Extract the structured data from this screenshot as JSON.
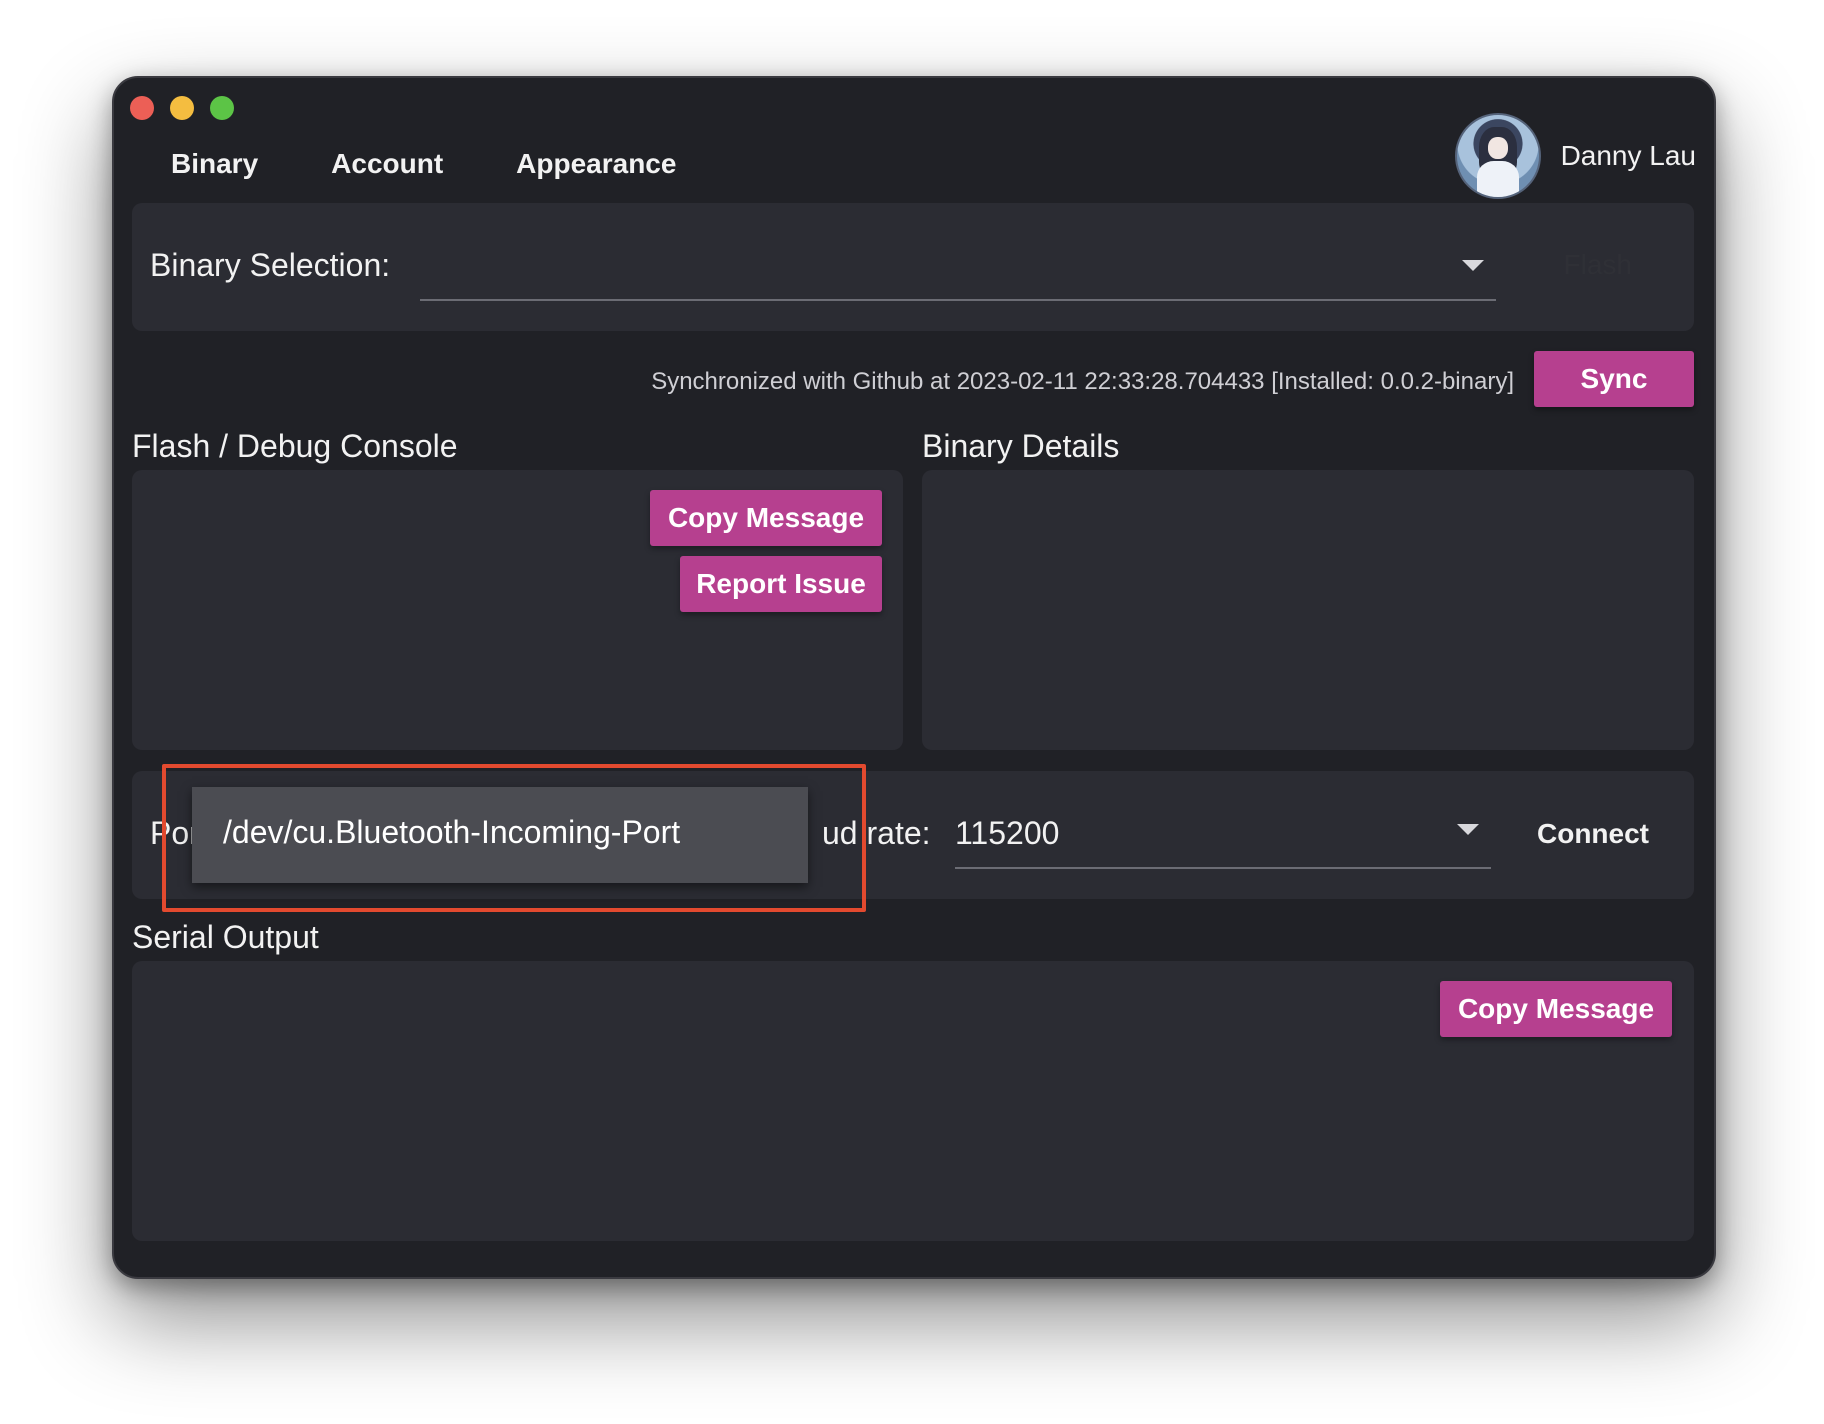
{
  "window": {
    "controls": [
      "close",
      "minimize",
      "maximize"
    ]
  },
  "nav": {
    "tabs": [
      {
        "label": "Binary"
      },
      {
        "label": "Account"
      },
      {
        "label": "Appearance"
      }
    ]
  },
  "user": {
    "name": "Danny Lau",
    "avatar_icon": "user-avatar"
  },
  "binary_selection": {
    "label": "Binary Selection:",
    "value": "",
    "flash_label": "Flash"
  },
  "sync": {
    "status": "Synchronized with Github at 2023-02-11 22:33:28.704433 [Installed: 0.0.2-binary]",
    "button_label": "Sync"
  },
  "console": {
    "title": "Flash / Debug Console",
    "copy_label": "Copy Message",
    "report_label": "Report Issue"
  },
  "details": {
    "title": "Binary Details"
  },
  "serial": {
    "port_label_visible": "Por",
    "port_dropdown_option": "/dev/cu.Bluetooth-Incoming-Port",
    "baud_label_visible": "ud rate:",
    "baud_value": "115200",
    "connect_label": "Connect",
    "output_title": "Serial Output",
    "copy_label": "Copy Message"
  },
  "colors": {
    "accent": "#b6408f",
    "window_bg": "#202126",
    "card_bg": "#2b2c33",
    "highlight": "#e34a2f"
  }
}
